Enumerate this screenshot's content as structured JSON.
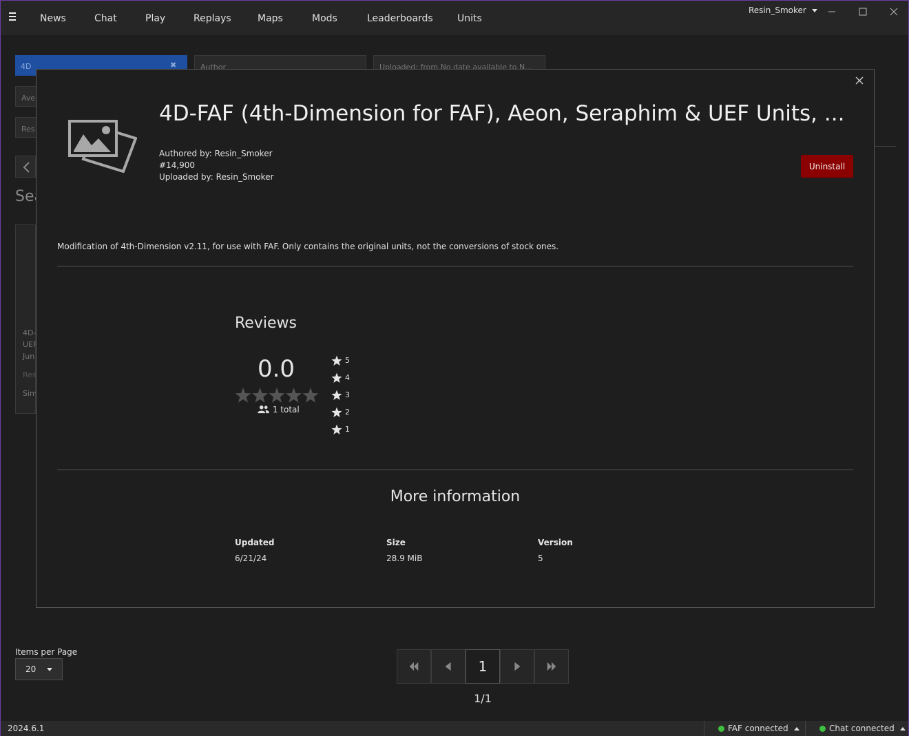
{
  "nav": {
    "items": [
      "News",
      "Chat",
      "Play",
      "Replays",
      "Maps",
      "Mods",
      "Leaderboards",
      "Units"
    ],
    "user": "Resin_Smoker"
  },
  "background": {
    "search_value": "4D",
    "author_placeholder": "Author",
    "uploaded_filter": "Uploaded: from No date available to N...",
    "sort_partial": "Aver",
    "reset_partial": "Res",
    "heading_partial": "Sea",
    "card_lines": [
      "4D-",
      "UEF",
      "Jun",
      "Res",
      "Sim"
    ]
  },
  "modal": {
    "title": "4D-FAF (4th-Dimension for FAF), Aeon, Seraphim & UEF Units, ...",
    "authored_by": "Authored by: Resin_Smoker",
    "id": "#14,900",
    "uploaded_by": "Uploaded by: Resin_Smoker",
    "uninstall_label": "Uninstall",
    "description": "Modification of 4th-Dimension v2.11, for use with FAF. Only contains the original units, not the conversions of stock ones.",
    "reviews": {
      "title": "Reviews",
      "score": "0.0",
      "rating_fraction": 0,
      "total": "1 total",
      "distribution": [
        "5",
        "4",
        "3",
        "2",
        "1"
      ]
    },
    "more_info": {
      "title": "More information",
      "updated_label": "Updated",
      "updated_value": "6/21/24",
      "size_label": "Size",
      "size_value": "28.9 MiB",
      "version_label": "Version",
      "version_value": "5"
    }
  },
  "pagination": {
    "items_per_page_label": "Items per Page",
    "items_per_page_value": "20",
    "current_page": "1",
    "page_count": "1/1"
  },
  "status": {
    "version": "2024.6.1",
    "faf": "FAF connected",
    "chat": "Chat connected",
    "connected_color": "#3fbf3f"
  },
  "colors": {
    "uninstall": "#8b0000",
    "search_highlight": "#1f4fa0"
  }
}
